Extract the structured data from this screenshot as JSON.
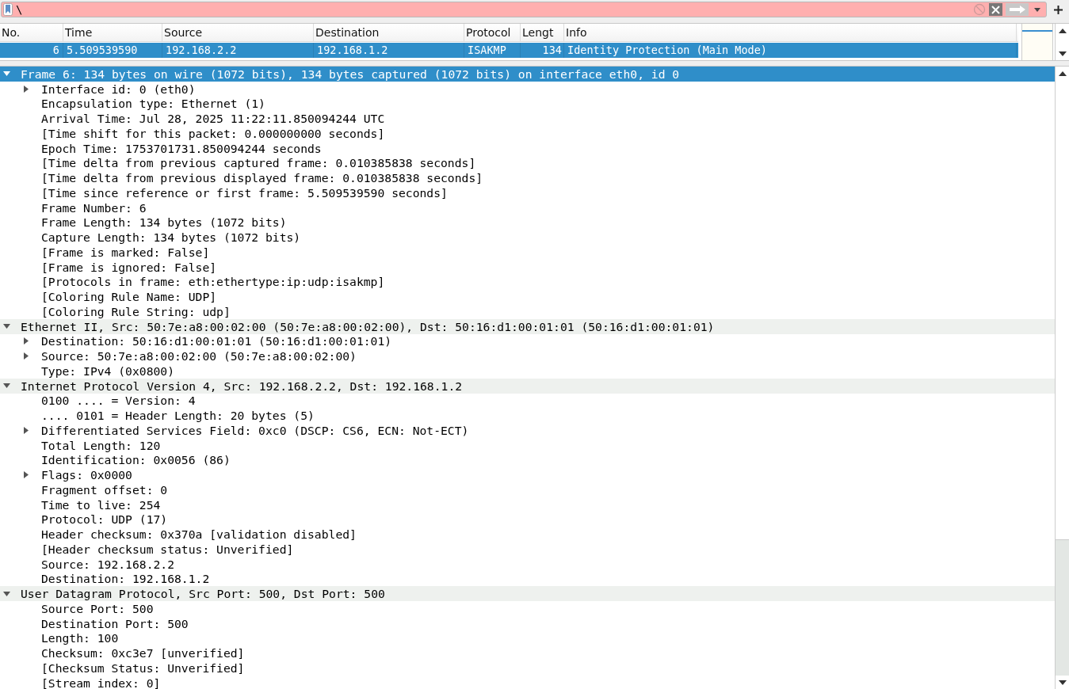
{
  "filter_bar": {
    "value": "\\"
  },
  "packet_list": {
    "columns": [
      "No.",
      "Time",
      "Source",
      "Destination",
      "Protocol",
      "Lengt",
      "Info"
    ],
    "rows": [
      {
        "cells": [
          "6",
          "5.509539590",
          "192.168.2.2",
          "192.168.1.2",
          "ISAKMP",
          "134",
          "Identity Protection (Main Mode)"
        ],
        "selected": true
      }
    ]
  },
  "packet_details": [
    {
      "text": "Frame 6: 134 bytes on wire (1072 bits), 134 bytes captured (1072 bits) on interface eth0, id 0",
      "expanded": true,
      "selected": true,
      "children": [
        {
          "text": "Interface id: 0 (eth0)",
          "kind": "branch",
          "expanded": false
        },
        {
          "text": "Encapsulation type: Ethernet (1)",
          "kind": "leaf"
        },
        {
          "text": "Arrival Time: Jul 28, 2025 11:22:11.850094244 UTC",
          "kind": "leaf"
        },
        {
          "text": "[Time shift for this packet: 0.000000000 seconds]",
          "kind": "leaf"
        },
        {
          "text": "Epoch Time: 1753701731.850094244 seconds",
          "kind": "leaf"
        },
        {
          "text": "[Time delta from previous captured frame: 0.010385838 seconds]",
          "kind": "leaf"
        },
        {
          "text": "[Time delta from previous displayed frame: 0.010385838 seconds]",
          "kind": "leaf"
        },
        {
          "text": "[Time since reference or first frame: 5.509539590 seconds]",
          "kind": "leaf"
        },
        {
          "text": "Frame Number: 6",
          "kind": "leaf"
        },
        {
          "text": "Frame Length: 134 bytes (1072 bits)",
          "kind": "leaf"
        },
        {
          "text": "Capture Length: 134 bytes (1072 bits)",
          "kind": "leaf"
        },
        {
          "text": "[Frame is marked: False]",
          "kind": "leaf"
        },
        {
          "text": "[Frame is ignored: False]",
          "kind": "leaf"
        },
        {
          "text": "[Protocols in frame: eth:ethertype:ip:udp:isakmp]",
          "kind": "leaf"
        },
        {
          "text": "[Coloring Rule Name: UDP]",
          "kind": "leaf"
        },
        {
          "text": "[Coloring Rule String: udp]",
          "kind": "leaf"
        }
      ]
    },
    {
      "text": "Ethernet II, Src: 50:7e:a8:00:02:00 (50:7e:a8:00:02:00), Dst: 50:16:d1:00:01:01 (50:16:d1:00:01:01)",
      "expanded": true,
      "selected": false,
      "children": [
        {
          "text": "Destination: 50:16:d1:00:01:01 (50:16:d1:00:01:01)",
          "kind": "branch",
          "expanded": false
        },
        {
          "text": "Source: 50:7e:a8:00:02:00 (50:7e:a8:00:02:00)",
          "kind": "branch",
          "expanded": false
        },
        {
          "text": "Type: IPv4 (0x0800)",
          "kind": "leaf"
        }
      ]
    },
    {
      "text": "Internet Protocol Version 4, Src: 192.168.2.2, Dst: 192.168.1.2",
      "expanded": true,
      "selected": false,
      "children": [
        {
          "text": "0100 .... = Version: 4",
          "kind": "leaf"
        },
        {
          "text": ".... 0101 = Header Length: 20 bytes (5)",
          "kind": "leaf"
        },
        {
          "text": "Differentiated Services Field: 0xc0 (DSCP: CS6, ECN: Not-ECT)",
          "kind": "branch",
          "expanded": false
        },
        {
          "text": "Total Length: 120",
          "kind": "leaf"
        },
        {
          "text": "Identification: 0x0056 (86)",
          "kind": "leaf"
        },
        {
          "text": "Flags: 0x0000",
          "kind": "branch",
          "expanded": false
        },
        {
          "text": "Fragment offset: 0",
          "kind": "leaf"
        },
        {
          "text": "Time to live: 254",
          "kind": "leaf"
        },
        {
          "text": "Protocol: UDP (17)",
          "kind": "leaf"
        },
        {
          "text": "Header checksum: 0x370a [validation disabled]",
          "kind": "leaf"
        },
        {
          "text": "[Header checksum status: Unverified]",
          "kind": "leaf"
        },
        {
          "text": "Source: 192.168.2.2",
          "kind": "leaf"
        },
        {
          "text": "Destination: 192.168.1.2",
          "kind": "leaf"
        }
      ]
    },
    {
      "text": "User Datagram Protocol, Src Port: 500, Dst Port: 500",
      "expanded": true,
      "selected": false,
      "children": [
        {
          "text": "Source Port: 500",
          "kind": "leaf"
        },
        {
          "text": "Destination Port: 500",
          "kind": "leaf"
        },
        {
          "text": "Length: 100",
          "kind": "leaf"
        },
        {
          "text": "Checksum: 0xc3e7 [unverified]",
          "kind": "leaf"
        },
        {
          "text": "[Checksum Status: Unverified]",
          "kind": "leaf"
        },
        {
          "text": "[Stream index: 0]",
          "kind": "leaf"
        }
      ]
    }
  ]
}
